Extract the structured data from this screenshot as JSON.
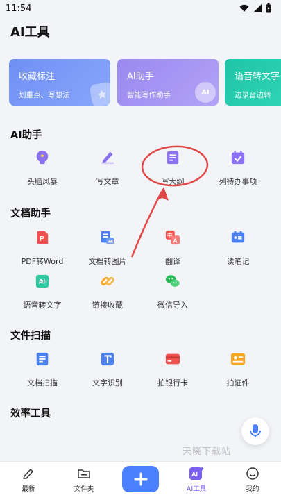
{
  "status_bar": {
    "time": "11:54"
  },
  "page_title": "AI工具",
  "cards": [
    {
      "title": "收藏标注",
      "subtitle": "划重点、写想法",
      "color": "#6f8ff5"
    },
    {
      "title": "AI助手",
      "subtitle": "智能写作助手",
      "badge": "AI",
      "color": "#9a88f0"
    },
    {
      "title": "语音转文字",
      "subtitle": "边录音边转",
      "color": "#21c9aa"
    }
  ],
  "sections": {
    "ai_assistant": {
      "title": "AI助手",
      "items": [
        {
          "label": "头脑风暴",
          "icon": "brain-icon"
        },
        {
          "label": "写文章",
          "icon": "pen-icon"
        },
        {
          "label": "写大纲",
          "icon": "outline-doc-icon"
        },
        {
          "label": "列待办事项",
          "icon": "calendar-check-icon"
        }
      ]
    },
    "doc_assistant": {
      "title": "文档助手",
      "items": [
        {
          "label": "PDF转Word",
          "icon": "pdf-icon"
        },
        {
          "label": "文档转图片",
          "icon": "doc-image-icon"
        },
        {
          "label": "翻译",
          "icon": "translate-icon"
        },
        {
          "label": "读笔记",
          "icon": "notes-icon"
        },
        {
          "label": "语音转文字",
          "icon": "audio-text-icon"
        },
        {
          "label": "链接收藏",
          "icon": "link-icon"
        },
        {
          "label": "微信导入",
          "icon": "wechat-icon"
        }
      ]
    },
    "file_scan": {
      "title": "文件扫描",
      "items": [
        {
          "label": "文档扫描",
          "icon": "doc-scan-icon"
        },
        {
          "label": "文字识别",
          "icon": "text-recognition-icon"
        },
        {
          "label": "拍银行卡",
          "icon": "bank-card-icon"
        },
        {
          "label": "拍证件",
          "icon": "id-card-icon"
        }
      ]
    },
    "efficiency": {
      "title": "效率工具"
    }
  },
  "watermark": "天晓下载站",
  "bottom_nav": [
    {
      "label": "最新",
      "icon": "edit-icon"
    },
    {
      "label": "文件夹",
      "icon": "folder-icon"
    },
    {
      "label": "",
      "icon": "plus-icon"
    },
    {
      "label": "AI工具",
      "icon": "ai-icon",
      "active": true
    },
    {
      "label": "我的",
      "icon": "smile-icon"
    }
  ],
  "colors": {
    "accent": "#4a80ff",
    "annotation_red": "#e04848",
    "background": "#f3f4f7"
  }
}
